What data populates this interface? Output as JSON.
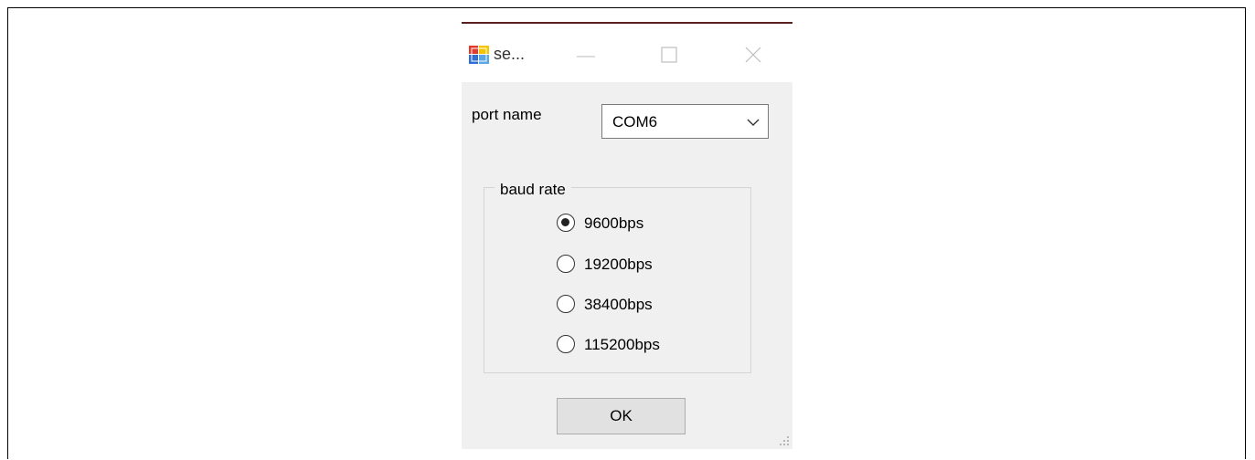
{
  "window": {
    "title": "se...",
    "minimize_glyph": "—",
    "maximize_glyph": "☐",
    "close_glyph": "✕"
  },
  "port": {
    "label": "port name",
    "selected": "COM6"
  },
  "baud_rate": {
    "legend": "baud rate",
    "options": [
      {
        "label": "9600bps",
        "checked": true
      },
      {
        "label": "19200bps",
        "checked": false
      },
      {
        "label": "38400bps",
        "checked": false
      },
      {
        "label": "115200bps",
        "checked": false
      }
    ]
  },
  "buttons": {
    "ok_label": "OK"
  }
}
